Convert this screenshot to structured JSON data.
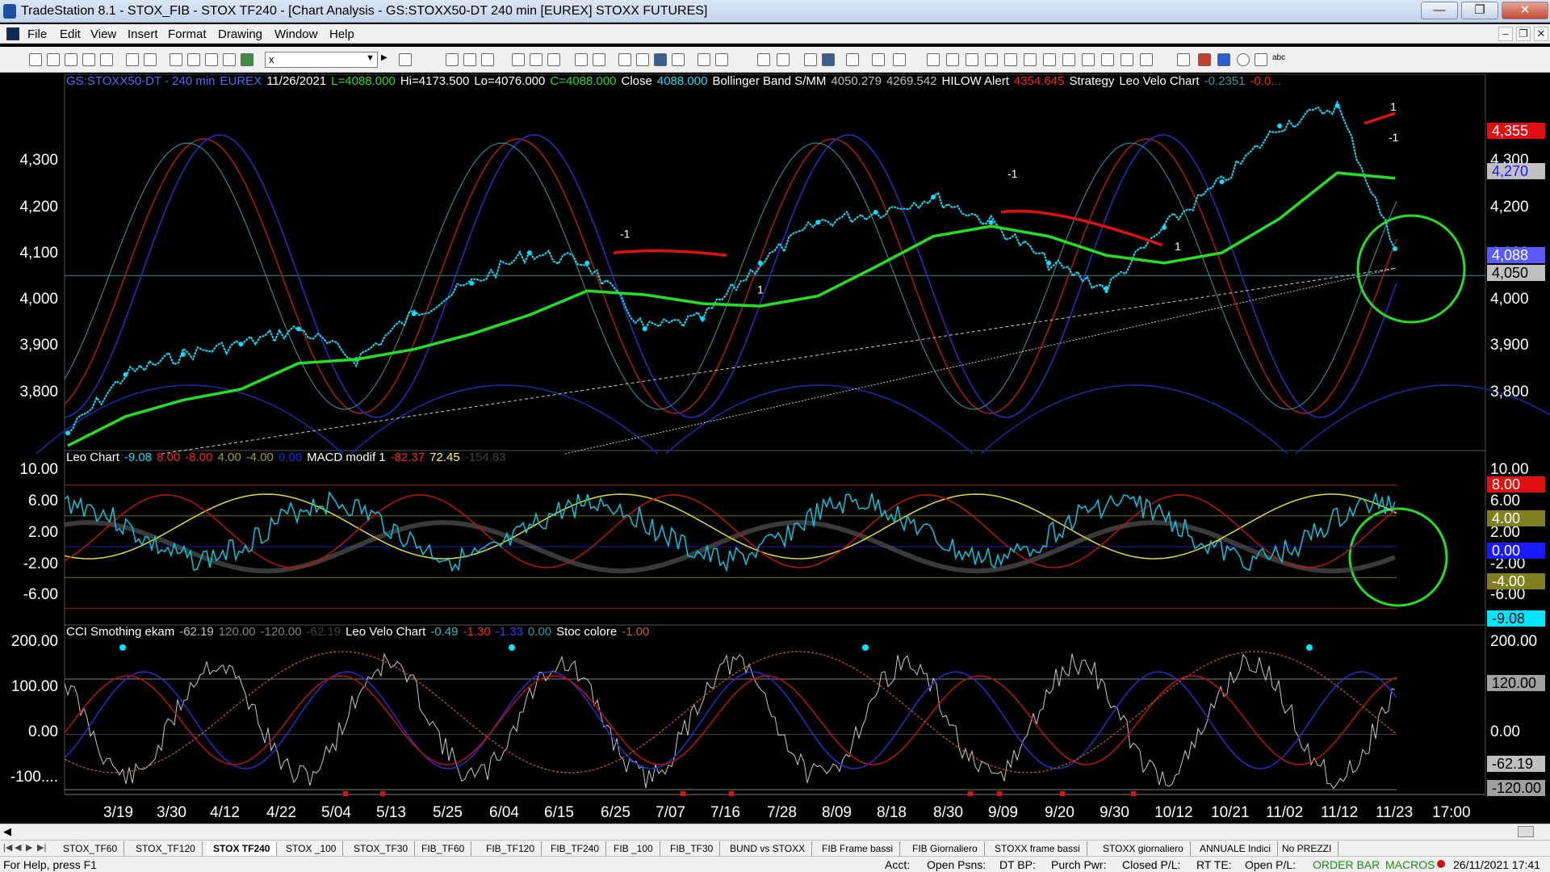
{
  "window": {
    "title": "TradeStation 8.1 - STOX_FIB - STOX TF240 - [Chart Analysis - GS:STOXX50-DT  240 min  [EUREX] STOXX FUTURES]",
    "btn_min": "—",
    "btn_max": "❐",
    "btn_close": "✕"
  },
  "menu": [
    "File",
    "Edit",
    "View",
    "Insert",
    "Format",
    "Drawing",
    "Window",
    "Help"
  ],
  "mdi": {
    "min": "–",
    "restore": "❐",
    "close": "✕"
  },
  "toolbar": {
    "symbol_value": "x",
    "symbol_arrow": "▼"
  },
  "legend_price": [
    {
      "text": "GS:STOXX50-DT - 240 min",
      "color": "#4a6cff"
    },
    {
      "text": "EUREX",
      "color": "#4a6cff"
    },
    {
      "text": "11/26/2021",
      "color": "#ffffff"
    },
    {
      "text": "L=4088.000",
      "color": "#20e020"
    },
    {
      "text": "Hi=4173.500",
      "color": "#ffffff"
    },
    {
      "text": "Lo=4076.000",
      "color": "#ffffff"
    },
    {
      "text": "C=4088.000",
      "color": "#20e020"
    },
    {
      "text": "Close",
      "color": "#ffffff"
    },
    {
      "text": "4088.000",
      "color": "#00e5ff"
    },
    {
      "text": "Bollinger Band S/MM",
      "color": "#ffffff"
    },
    {
      "text": "4050.279",
      "color": "#c0c0c0"
    },
    {
      "text": "4269.542",
      "color": "#c0c0c0"
    },
    {
      "text": "HILOW Alert",
      "color": "#ffffff"
    },
    {
      "text": "4354.645",
      "color": "#ff2020"
    },
    {
      "text": "Strategy",
      "color": "#ffffff"
    },
    {
      "text": "Leo Velo Chart",
      "color": "#ffffff"
    },
    {
      "text": "-0.2351",
      "color": "#20a0a0"
    },
    {
      "text": "-0.0...",
      "color": "#ff2020"
    }
  ],
  "legend_mid": [
    {
      "text": "Leo Chart",
      "color": "#ffffff"
    },
    {
      "text": "-9.08",
      "color": "#00e5ff"
    },
    {
      "text": "8.00",
      "color": "#ff2020"
    },
    {
      "text": "-8.00",
      "color": "#ff2020"
    },
    {
      "text": "4.00",
      "color": "#a0a020"
    },
    {
      "text": "-4.00",
      "color": "#a0a020"
    },
    {
      "text": "0.00",
      "color": "#2020ff"
    },
    {
      "text": "MACD modif 1",
      "color": "#ffffff"
    },
    {
      "text": "-82.37",
      "color": "#ff2020"
    },
    {
      "text": "72.45",
      "color": "#ffff40"
    },
    {
      "text": "-154.83",
      "color": "#404040"
    }
  ],
  "legend_low": [
    {
      "text": "CCI Smothing ekam",
      "color": "#ffffff"
    },
    {
      "text": "-62.19",
      "color": "#c0c0c0"
    },
    {
      "text": "120.00",
      "color": "#808080"
    },
    {
      "text": "-120.00",
      "color": "#808080"
    },
    {
      "text": "-62.19",
      "color": "#404040"
    },
    {
      "text": "Leo Velo Chart",
      "color": "#ffffff"
    },
    {
      "text": "-0.49",
      "color": "#20c0c0"
    },
    {
      "text": "-1.30",
      "color": "#ff2020"
    },
    {
      "text": "-1.33",
      "color": "#2040ff"
    },
    {
      "text": "0.00",
      "color": "#20a0a0"
    },
    {
      "text": "Stoc colore",
      "color": "#ffffff"
    },
    {
      "text": "-1.00",
      "color": "#c06020"
    }
  ],
  "price_axis": {
    "left_ticks": [
      "4,300",
      "4,200",
      "4,100",
      "4,000",
      "3,900",
      "3,800"
    ],
    "right_ticks": [
      "4,300",
      "4,200",
      "4,100",
      "4,000",
      "3,900",
      "3,800"
    ],
    "badges": [
      {
        "label": "4,355",
        "bg": "#e01010",
        "fg": "#ffffff"
      },
      {
        "label": "4,270",
        "bg": "#c0c0c0",
        "fg": "#1a1aff"
      },
      {
        "label": "4,088",
        "bg": "#5a5aff",
        "fg": "#ffffff"
      },
      {
        "label": "4,050",
        "bg": "#c0c0c0",
        "fg": "#000000"
      }
    ]
  },
  "mid_axis": {
    "left_ticks": [
      "10.00",
      "6.00",
      "2.00",
      "-2.00",
      "-6.00"
    ],
    "right_ticks": [
      "10.00",
      "6.00",
      "2.00",
      "-2.00",
      "-6.00"
    ],
    "badges": [
      {
        "label": "8.00",
        "bg": "#e01010",
        "fg": "#ffffff"
      },
      {
        "label": "4.00",
        "bg": "#808020",
        "fg": "#ffffff"
      },
      {
        "label": "0.00",
        "bg": "#1a1aff",
        "fg": "#ffffff"
      },
      {
        "label": "-4.00",
        "bg": "#808020",
        "fg": "#ffffff"
      },
      {
        "label": "-9.08",
        "bg": "#00e5ff",
        "fg": "#000000"
      }
    ]
  },
  "low_axis": {
    "left_ticks": [
      "200.00",
      "100.00",
      "0.00",
      "-100...."
    ],
    "right_ticks": [
      "200.00",
      "100.00",
      "0.00"
    ],
    "badges": [
      {
        "label": "120.00",
        "bg": "#a0a0a0",
        "fg": "#000000"
      },
      {
        "label": "-62.19",
        "bg": "#c0c0c0",
        "fg": "#000000"
      },
      {
        "label": "-120.00",
        "bg": "#a0a0a0",
        "fg": "#000000"
      }
    ]
  },
  "x_axis": [
    "3/19",
    "3/30",
    "4/12",
    "4/22",
    "5/04",
    "5/13",
    "5/25",
    "6/04",
    "6/15",
    "6/25",
    "7/07",
    "7/16",
    "7/28",
    "8/09",
    "8/18",
    "8/30",
    "9/09",
    "9/20",
    "9/30",
    "10/12",
    "10/21",
    "11/02",
    "11/12",
    "11/23",
    "17:00"
  ],
  "chart_markers": [
    "-1",
    "1",
    "-1",
    "1",
    "1",
    "-1"
  ],
  "tabs": {
    "nav": [
      "|◀",
      "◀",
      "▶",
      "▶|"
    ],
    "items": [
      "STOX_TF60",
      "STOX_TF120",
      "STOX TF240",
      "STOX _100",
      "STOX_TF30",
      "FIB_TF60",
      "FIB_TF120",
      "FIB_TF240",
      "FIB _100",
      "FIB_TF30",
      "BUND vs STOXX",
      "FIB Frame bassi",
      "FIB Giornaliero",
      "STOXX frame bassi",
      "STOXX giornaliero",
      "ANNUALE Indici",
      "No PREZZI"
    ],
    "active": "STOX TF240"
  },
  "status": {
    "help": "For Help, press F1",
    "acct": "Acct:",
    "open_psns": "Open Psns:",
    "dt_bp": "DT BP:",
    "purch_pwr": "Purch Pwr:",
    "closed_pl": "Closed P/L:",
    "rt_te": "RT TE:",
    "open_pl": "Open P/L:",
    "order_bar": "ORDER BAR",
    "macros": "MACROS",
    "datetime": "26/11/2021 17:41"
  },
  "chart_data": {
    "type": "line",
    "panes": [
      {
        "name": "price",
        "ylim": [
          3700,
          4400
        ],
        "x": [
          "3/19",
          "3/30",
          "4/12",
          "4/22",
          "5/04",
          "5/13",
          "5/25",
          "6/04",
          "6/15",
          "6/25",
          "7/07",
          "7/16",
          "7/28",
          "8/09",
          "8/18",
          "8/30",
          "9/09",
          "9/20",
          "9/30",
          "10/12",
          "10/21",
          "11/02",
          "11/12",
          "11/23"
        ],
        "series": [
          {
            "name": "Close",
            "color": "#00e5ff",
            "values": [
              3725,
              3840,
              3880,
              3900,
              3930,
              3870,
              3960,
              4020,
              4080,
              4060,
              3930,
              3950,
              4060,
              4140,
              4160,
              4190,
              4140,
              4060,
              4010,
              4130,
              4220,
              4330,
              4370,
              4088
            ]
          }
        ]
      },
      {
        "name": "Leo Chart",
        "ylim": [
          -9.5,
          11
        ]
      },
      {
        "name": "CCI Smothing ekam",
        "ylim": [
          -120,
          220
        ]
      }
    ]
  }
}
